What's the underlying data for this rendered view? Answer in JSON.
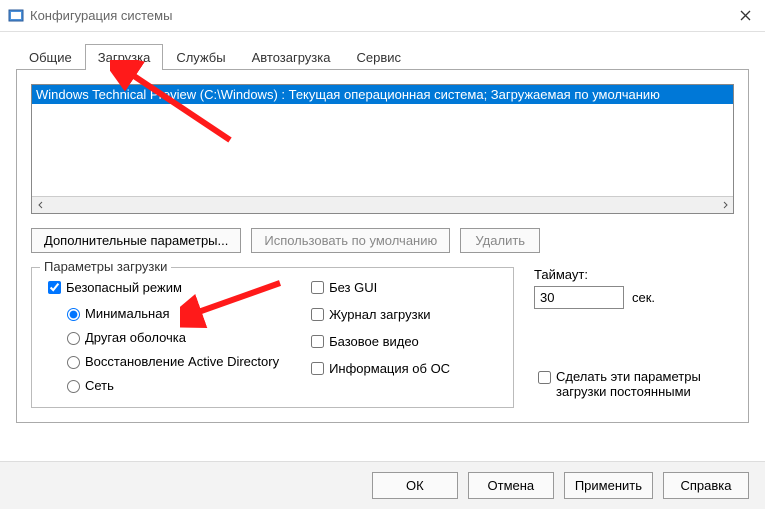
{
  "window": {
    "title": "Конфигурация системы"
  },
  "tabs": {
    "general": "Общие",
    "boot": "Загрузка",
    "services": "Службы",
    "startup": "Автозагрузка",
    "tools": "Сервис"
  },
  "boot_list": {
    "entry": "Windows Technical Preview (C:\\Windows) : Текущая операционная система; Загружаемая по умолчанию"
  },
  "buttons": {
    "advanced": "Дополнительные параметры...",
    "set_default": "Использовать по умолчанию",
    "delete": "Удалить"
  },
  "group": {
    "title": "Параметры загрузки",
    "safe_mode": "Безопасный режим",
    "minimal": "Минимальная",
    "alt_shell": "Другая оболочка",
    "ad_repair": "Восстановление Active Directory",
    "network": "Сеть",
    "no_gui": "Без GUI",
    "boot_log": "Журнал загрузки",
    "base_video": "Базовое видео",
    "os_info": "Информация  об ОС"
  },
  "timeout": {
    "label": "Таймаут:",
    "value": "30",
    "unit": "сек."
  },
  "persist": {
    "label": "Сделать эти параметры загрузки постоянными"
  },
  "footer": {
    "ok": "ОК",
    "cancel": "Отмена",
    "apply": "Применить",
    "help": "Справка"
  }
}
